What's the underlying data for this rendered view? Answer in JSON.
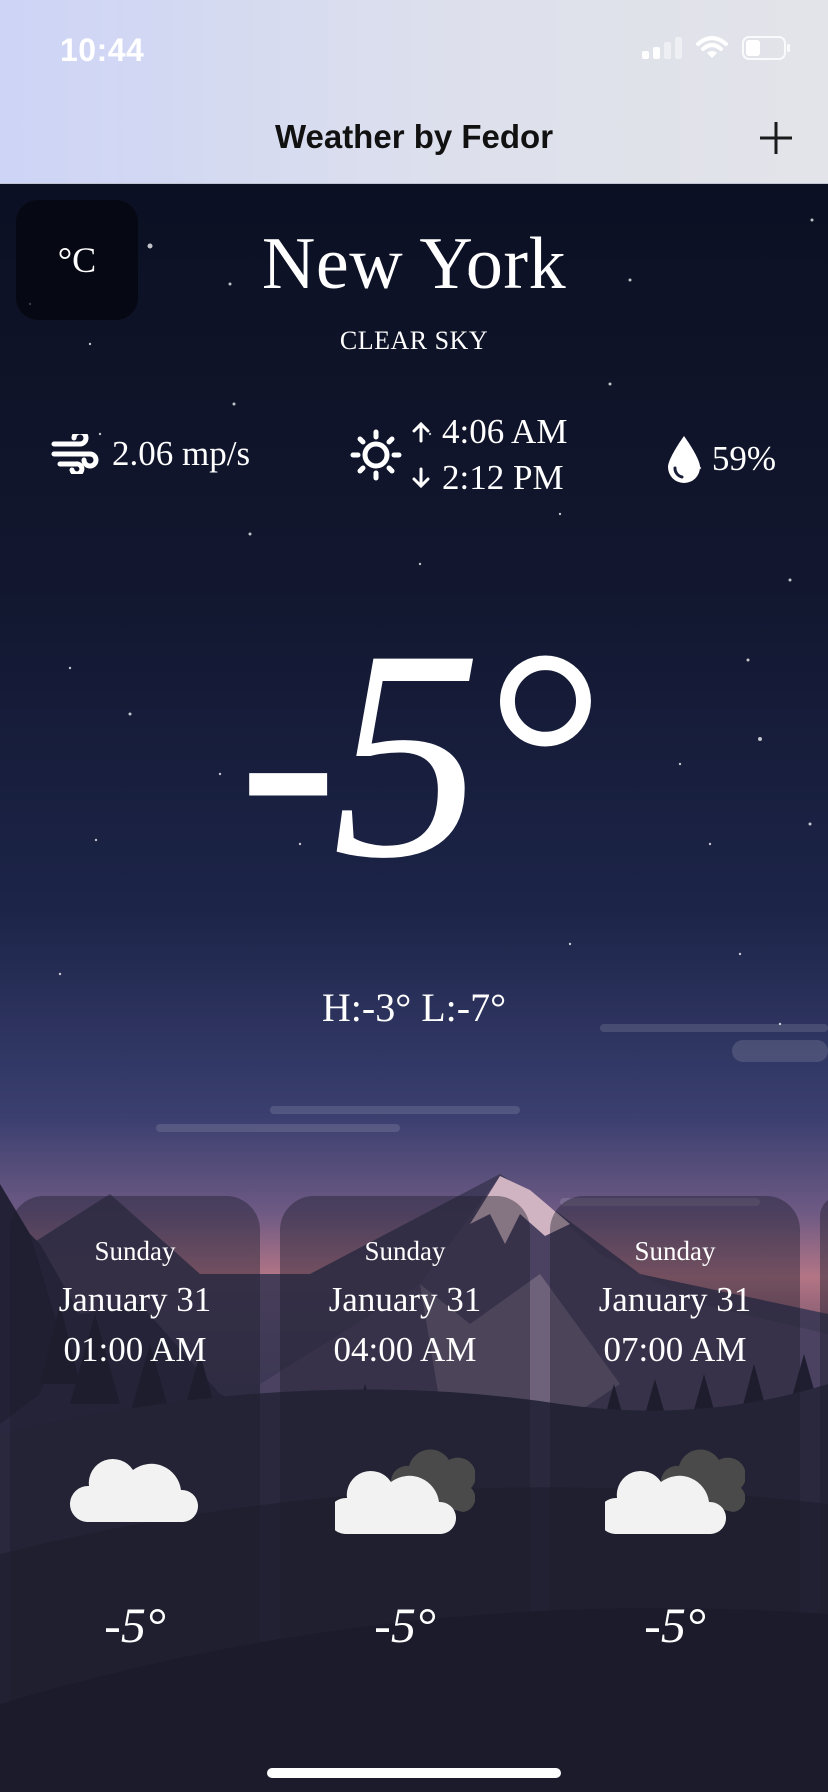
{
  "status_bar": {
    "time": "10:44",
    "icons": [
      "signal-icon",
      "wifi-icon",
      "battery-icon"
    ]
  },
  "nav": {
    "title": "Weather by Fedor",
    "add_icon": "plus-icon"
  },
  "unit_toggle": {
    "label": "°C"
  },
  "location": {
    "city": "New York",
    "condition": "CLEAR SKY"
  },
  "details": {
    "wind": "2.06 mp/s",
    "sunrise": "4:06 AM",
    "sunset": "2:12 PM",
    "humidity": "59%"
  },
  "current": {
    "temperature": "-5°",
    "high_low": "H:-3° L:-7°"
  },
  "forecast": [
    {
      "day": "Sunday",
      "date": "January 31",
      "time": "01:00 AM",
      "icon": "cloud-icon",
      "temp": "-5°"
    },
    {
      "day": "Sunday",
      "date": "January 31",
      "time": "04:00 AM",
      "icon": "clouds-icon",
      "temp": "-5°"
    },
    {
      "day": "Sunday",
      "date": "January 31",
      "time": "07:00 AM",
      "icon": "clouds-icon",
      "temp": "-5°"
    }
  ],
  "colors": {
    "nav_gradient_start": "#cdd4f6",
    "nav_gradient_end": "#e3e4e9",
    "sky_top": "#0c1023",
    "sunset_glow": "#b37585"
  }
}
